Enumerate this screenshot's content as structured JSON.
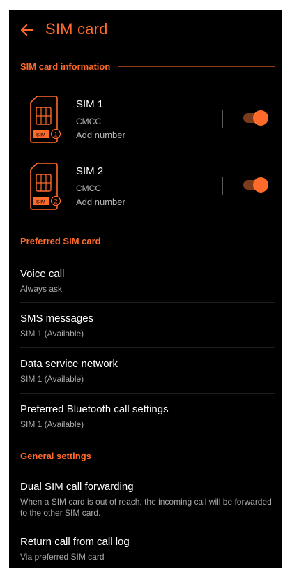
{
  "header": {
    "title": "SIM card"
  },
  "sections": {
    "sim_info": "SIM card information",
    "preferred": "Preferred SIM card",
    "general": "General settings"
  },
  "sims": [
    {
      "name": "SIM 1",
      "carrier": "CMCC",
      "number": "Add number",
      "badge": "SIM",
      "index": "1",
      "enabled": true
    },
    {
      "name": "SIM 2",
      "carrier": "CMCC",
      "number": "Add number",
      "badge": "SIM",
      "index": "2",
      "enabled": true
    }
  ],
  "preferred_items": [
    {
      "title": "Voice call",
      "subtitle": "Always ask"
    },
    {
      "title": "SMS messages",
      "subtitle": "SIM 1 (Available)"
    },
    {
      "title": "Data service network",
      "subtitle": "SIM 1 (Available)"
    },
    {
      "title": "Preferred Bluetooth call settings",
      "subtitle": "SIM 1 (Available)"
    }
  ],
  "general_items": [
    {
      "title": "Dual SIM call forwarding",
      "subtitle": "When a SIM card is out of reach, the incoming call will be forwarded to the other SIM card."
    },
    {
      "title": "Return call from call log",
      "subtitle": "Via preferred SIM card"
    }
  ],
  "colors": {
    "accent": "#ff6a2b",
    "background": "#000000",
    "toggle_track": "#7a3a1c"
  },
  "icons": {
    "back": "arrow-left-icon",
    "sim": "sim-card-icon"
  }
}
